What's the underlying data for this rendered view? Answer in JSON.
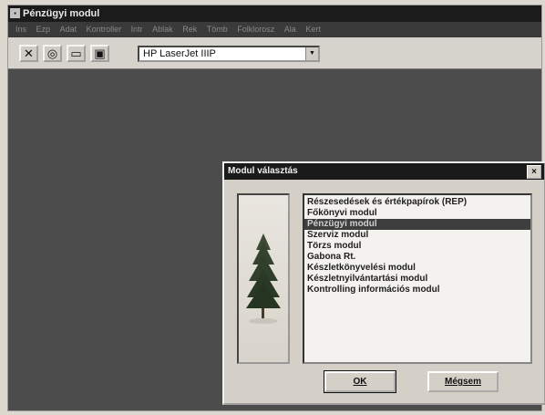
{
  "window": {
    "title": "Pénzügyi modul",
    "menu": [
      "Ins",
      "Ezp",
      "Adat",
      "Kontroller",
      "Intr",
      "Ablak",
      "Rek",
      "Tömb",
      "Folklorosz",
      "Ala",
      "Kert"
    ]
  },
  "toolbar": {
    "buttons": [
      {
        "icon": "close-x-icon",
        "glyph": "✕"
      },
      {
        "icon": "circle-icon",
        "glyph": "◎"
      },
      {
        "icon": "print-icon",
        "glyph": "▭"
      },
      {
        "icon": "document-icon",
        "glyph": "▣"
      }
    ],
    "printer_value": "HP LaserJet IIIP"
  },
  "dialog": {
    "title": "Modul választás",
    "close_glyph": "×",
    "modules": [
      "Részesedések és értékpapírok (REP)",
      "Főkönyvi modul",
      "Pénzügyi modul",
      "Szerviz modul",
      "Törzs modul",
      "Gabona Rt.",
      "Készletkönyvelési modul",
      "Készletnyilvántartási modul",
      "Kontrolling információs modul"
    ],
    "selected_index": 2,
    "ok_label": "OK",
    "cancel_label": "Mégsem"
  },
  "colors": {
    "workspace": "#4c4c4c",
    "titlebar": "#1b1b1b",
    "selection": "#3e3e3e",
    "dialog_face": "#d4d0c8"
  }
}
